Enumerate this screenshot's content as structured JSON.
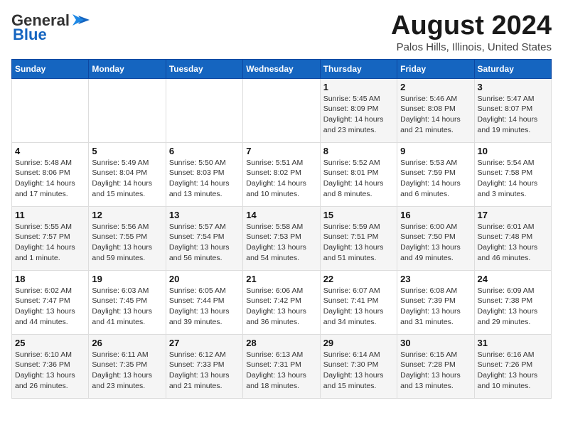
{
  "logo": {
    "line1": "General",
    "line2": "Blue",
    "bird_symbol": "▶"
  },
  "title": "August 2024",
  "subtitle": "Palos Hills, Illinois, United States",
  "weekdays": [
    "Sunday",
    "Monday",
    "Tuesday",
    "Wednesday",
    "Thursday",
    "Friday",
    "Saturday"
  ],
  "weeks": [
    [
      {
        "day": "",
        "text": ""
      },
      {
        "day": "",
        "text": ""
      },
      {
        "day": "",
        "text": ""
      },
      {
        "day": "",
        "text": ""
      },
      {
        "day": "1",
        "text": "Sunrise: 5:45 AM\nSunset: 8:09 PM\nDaylight: 14 hours\nand 23 minutes."
      },
      {
        "day": "2",
        "text": "Sunrise: 5:46 AM\nSunset: 8:08 PM\nDaylight: 14 hours\nand 21 minutes."
      },
      {
        "day": "3",
        "text": "Sunrise: 5:47 AM\nSunset: 8:07 PM\nDaylight: 14 hours\nand 19 minutes."
      }
    ],
    [
      {
        "day": "4",
        "text": "Sunrise: 5:48 AM\nSunset: 8:06 PM\nDaylight: 14 hours\nand 17 minutes."
      },
      {
        "day": "5",
        "text": "Sunrise: 5:49 AM\nSunset: 8:04 PM\nDaylight: 14 hours\nand 15 minutes."
      },
      {
        "day": "6",
        "text": "Sunrise: 5:50 AM\nSunset: 8:03 PM\nDaylight: 14 hours\nand 13 minutes."
      },
      {
        "day": "7",
        "text": "Sunrise: 5:51 AM\nSunset: 8:02 PM\nDaylight: 14 hours\nand 10 minutes."
      },
      {
        "day": "8",
        "text": "Sunrise: 5:52 AM\nSunset: 8:01 PM\nDaylight: 14 hours\nand 8 minutes."
      },
      {
        "day": "9",
        "text": "Sunrise: 5:53 AM\nSunset: 7:59 PM\nDaylight: 14 hours\nand 6 minutes."
      },
      {
        "day": "10",
        "text": "Sunrise: 5:54 AM\nSunset: 7:58 PM\nDaylight: 14 hours\nand 3 minutes."
      }
    ],
    [
      {
        "day": "11",
        "text": "Sunrise: 5:55 AM\nSunset: 7:57 PM\nDaylight: 14 hours\nand 1 minute."
      },
      {
        "day": "12",
        "text": "Sunrise: 5:56 AM\nSunset: 7:55 PM\nDaylight: 13 hours\nand 59 minutes."
      },
      {
        "day": "13",
        "text": "Sunrise: 5:57 AM\nSunset: 7:54 PM\nDaylight: 13 hours\nand 56 minutes."
      },
      {
        "day": "14",
        "text": "Sunrise: 5:58 AM\nSunset: 7:53 PM\nDaylight: 13 hours\nand 54 minutes."
      },
      {
        "day": "15",
        "text": "Sunrise: 5:59 AM\nSunset: 7:51 PM\nDaylight: 13 hours\nand 51 minutes."
      },
      {
        "day": "16",
        "text": "Sunrise: 6:00 AM\nSunset: 7:50 PM\nDaylight: 13 hours\nand 49 minutes."
      },
      {
        "day": "17",
        "text": "Sunrise: 6:01 AM\nSunset: 7:48 PM\nDaylight: 13 hours\nand 46 minutes."
      }
    ],
    [
      {
        "day": "18",
        "text": "Sunrise: 6:02 AM\nSunset: 7:47 PM\nDaylight: 13 hours\nand 44 minutes."
      },
      {
        "day": "19",
        "text": "Sunrise: 6:03 AM\nSunset: 7:45 PM\nDaylight: 13 hours\nand 41 minutes."
      },
      {
        "day": "20",
        "text": "Sunrise: 6:05 AM\nSunset: 7:44 PM\nDaylight: 13 hours\nand 39 minutes."
      },
      {
        "day": "21",
        "text": "Sunrise: 6:06 AM\nSunset: 7:42 PM\nDaylight: 13 hours\nand 36 minutes."
      },
      {
        "day": "22",
        "text": "Sunrise: 6:07 AM\nSunset: 7:41 PM\nDaylight: 13 hours\nand 34 minutes."
      },
      {
        "day": "23",
        "text": "Sunrise: 6:08 AM\nSunset: 7:39 PM\nDaylight: 13 hours\nand 31 minutes."
      },
      {
        "day": "24",
        "text": "Sunrise: 6:09 AM\nSunset: 7:38 PM\nDaylight: 13 hours\nand 29 minutes."
      }
    ],
    [
      {
        "day": "25",
        "text": "Sunrise: 6:10 AM\nSunset: 7:36 PM\nDaylight: 13 hours\nand 26 minutes."
      },
      {
        "day": "26",
        "text": "Sunrise: 6:11 AM\nSunset: 7:35 PM\nDaylight: 13 hours\nand 23 minutes."
      },
      {
        "day": "27",
        "text": "Sunrise: 6:12 AM\nSunset: 7:33 PM\nDaylight: 13 hours\nand 21 minutes."
      },
      {
        "day": "28",
        "text": "Sunrise: 6:13 AM\nSunset: 7:31 PM\nDaylight: 13 hours\nand 18 minutes."
      },
      {
        "day": "29",
        "text": "Sunrise: 6:14 AM\nSunset: 7:30 PM\nDaylight: 13 hours\nand 15 minutes."
      },
      {
        "day": "30",
        "text": "Sunrise: 6:15 AM\nSunset: 7:28 PM\nDaylight: 13 hours\nand 13 minutes."
      },
      {
        "day": "31",
        "text": "Sunrise: 6:16 AM\nSunset: 7:26 PM\nDaylight: 13 hours\nand 10 minutes."
      }
    ]
  ]
}
